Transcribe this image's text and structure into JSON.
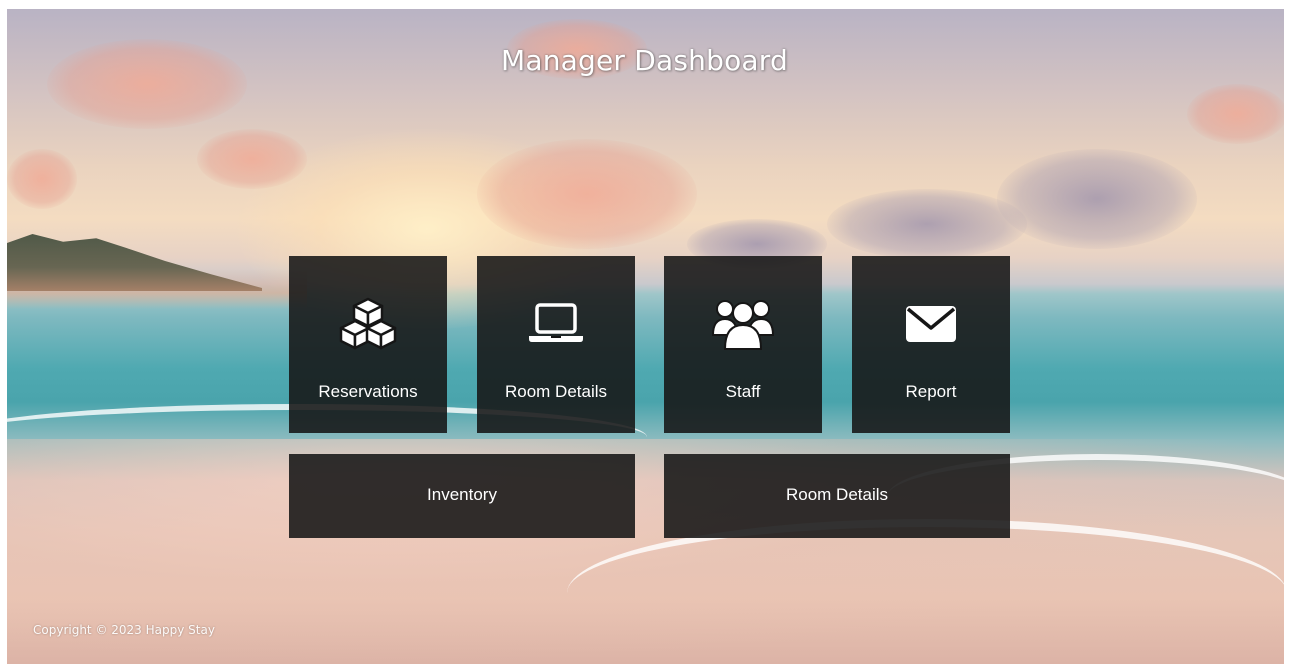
{
  "header": {
    "title": "Manager Dashboard"
  },
  "tiles": [
    {
      "label": "Reservations",
      "icon": "cubes-icon"
    },
    {
      "label": "Room Details",
      "icon": "laptop-icon"
    },
    {
      "label": "Staff",
      "icon": "users-icon"
    },
    {
      "label": "Report",
      "icon": "envelope-icon"
    }
  ],
  "wide_tiles": [
    {
      "label": "Inventory"
    },
    {
      "label": "Room Details"
    }
  ],
  "footer": {
    "text": "Copyright © 2023 Happy Stay"
  },
  "colors": {
    "tile_bg": "#161616",
    "text": "#ffffff"
  }
}
